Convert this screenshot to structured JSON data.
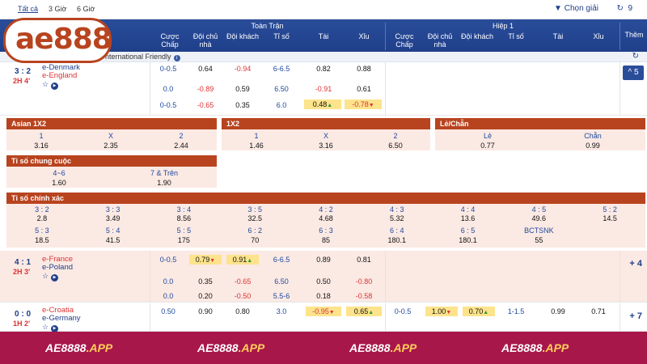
{
  "topbar": {
    "filters": [
      "Tất cả",
      "3 Giờ",
      "6 Giờ"
    ],
    "filter_label": "Chọn giải",
    "refresh_count": "9"
  },
  "logo": {
    "text": "ae888"
  },
  "header": {
    "group_full": "Toàn Trận",
    "group_half": "Hiệp 1",
    "more": "Thêm",
    "cols": [
      "Cược\nChấp",
      "Đội chủ\nnhà",
      "Đội khách",
      "Tỉ số",
      "Tài",
      "Xỉu"
    ]
  },
  "league": {
    "name": "nternational Friendly"
  },
  "matches": [
    {
      "score": "3 : 2",
      "time": "2H 4'",
      "home": "e-Denmark",
      "away": "e-England",
      "more": "5",
      "lines": [
        {
          "hdp": "0-0.5",
          "home": "0.64",
          "away": "-0.94",
          "ou": "6-6.5",
          "over": "0.82",
          "under": "0.88"
        },
        {
          "hdp": "0.0",
          "home": "-0.89",
          "away": "0.59",
          "ou": "6.50",
          "over": "-0.91",
          "under": "0.61"
        },
        {
          "hdp": "0-0.5",
          "home": "-0.65",
          "away": "0.35",
          "ou": "6.0",
          "over": "0.48",
          "under": "-0.78"
        }
      ]
    },
    {
      "score": "4 : 1",
      "time": "2H 3'",
      "home": "e-France",
      "away": "e-Poland",
      "more": "+ 4",
      "lines": [
        {
          "hdp": "0-0.5",
          "home": "0.79",
          "away": "0.91",
          "ou": "6-6.5",
          "over": "0.89",
          "under": "0.81"
        },
        {
          "hdp": "0.0",
          "home": "0.35",
          "away": "-0.65",
          "ou": "6.50",
          "over": "0.50",
          "under": "-0.80"
        },
        {
          "hdp": "0.0",
          "home": "0.20",
          "away": "-0.50",
          "ou": "5.5-6",
          "over": "0.18",
          "under": "-0.58"
        }
      ]
    },
    {
      "score": "0 : 0",
      "time": "1H 2'",
      "home": "e-Croatia",
      "away": "e-Germany",
      "more": "+ 7",
      "lines": [
        {
          "hdp": "0.50",
          "home": "0.90",
          "away": "0.80",
          "ou": "3.0",
          "over": "-0.95",
          "under": "0.65",
          "h_hdp": "0-0.5",
          "h_home": "1.00",
          "h_away": "0.70",
          "h_ou": "1-1.5",
          "h_over": "0.99",
          "h_under": "0.71"
        }
      ]
    }
  ],
  "panels": {
    "asian": {
      "title": "Asian 1X2",
      "labels": [
        "1",
        "X",
        "2"
      ],
      "values": [
        "3.16",
        "2.35",
        "2.44"
      ]
    },
    "onex2": {
      "title": "1X2",
      "labels": [
        "1",
        "X",
        "2"
      ],
      "values": [
        "1.46",
        "3.16",
        "6.50"
      ]
    },
    "oddeven": {
      "title": "Lẻ/Chẵn",
      "labels": [
        "Lẻ",
        "Chẵn"
      ],
      "values": [
        "0.77",
        "0.99"
      ]
    },
    "total": {
      "title": "Tỉ số chung cuộc",
      "labels": [
        "4~6",
        "7 & Trên"
      ],
      "values": [
        "1.60",
        "1.90"
      ]
    },
    "correct": {
      "title": "Tỉ số chính xác",
      "row1_labels": [
        "3 : 2",
        "3 : 3",
        "3 : 4",
        "3 : 5",
        "4 : 2",
        "4 : 3",
        "4 : 4",
        "4 : 5",
        "5 : 2"
      ],
      "row1_values": [
        "2.8",
        "3.49",
        "8.56",
        "32.5",
        "4.68",
        "5.32",
        "13.6",
        "49.6",
        "14.5"
      ],
      "row2_labels": [
        "5 : 3",
        "5 : 4",
        "5 : 5",
        "6 : 2",
        "6 : 3",
        "6 : 4",
        "6 : 5",
        "BCTSNK"
      ],
      "row2_values": [
        "18.5",
        "41.5",
        "175",
        "70",
        "85",
        "180.1",
        "180.1",
        "55"
      ]
    }
  },
  "footer": {
    "brand": "AE8888",
    "suffix": ".APP"
  }
}
